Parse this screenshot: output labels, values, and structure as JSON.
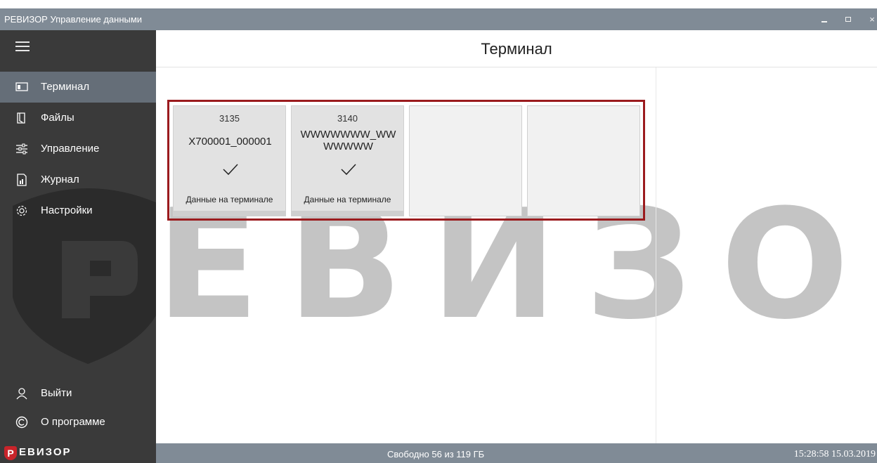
{
  "window": {
    "title": "РЕВИЗОР Управление данными",
    "min_label": "_",
    "close_label": "×"
  },
  "sidebar": {
    "items": [
      {
        "label": "Терминал",
        "icon": "terminal-icon",
        "active": true
      },
      {
        "label": "Файлы",
        "icon": "files-icon"
      },
      {
        "label": "Управление",
        "icon": "sliders-icon"
      },
      {
        "label": "Журнал",
        "icon": "journal-icon"
      },
      {
        "label": "Настройки",
        "icon": "gear-icon"
      }
    ],
    "bottom": [
      {
        "label": "Выйти",
        "icon": "user-icon"
      },
      {
        "label": "О программе",
        "icon": "copyright-icon"
      }
    ]
  },
  "header": {
    "title": "Терминал"
  },
  "watermark": {
    "text": "ЕВИЗОР"
  },
  "tiles": [
    {
      "number": "3135",
      "name": "X700001_000001",
      "status": "Данные на терминале"
    },
    {
      "number": "3140",
      "name": "WWWWWWW_WWWWWWW",
      "status": "Данные на терминале"
    },
    {
      "number": "",
      "name": "",
      "status": ""
    },
    {
      "number": "",
      "name": "",
      "status": ""
    }
  ],
  "statusbar": {
    "logo_letter": "Р",
    "logo_text": "ЕВИЗОР",
    "free_space": "Свободно 56 из 119 ГБ",
    "datetime": "15:28:58 15.03.2019"
  },
  "colors": {
    "accent_red": "#9b1b1e",
    "sidebar_bg": "#3a3a3a",
    "sidebar_active": "#656e78",
    "bar_bg": "#808b96"
  }
}
